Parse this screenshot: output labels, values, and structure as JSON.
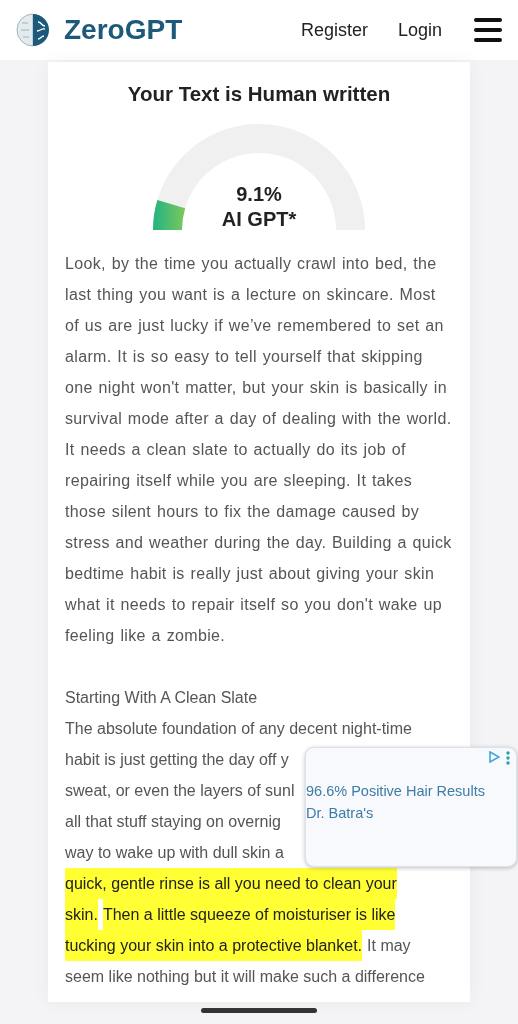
{
  "header": {
    "brand": "ZeroGPT",
    "nav": [
      "Register",
      "Login"
    ]
  },
  "result": {
    "title": "Your Text is Human written",
    "gauge": {
      "reading": "9.1%",
      "caption": "AI GPT*"
    }
  },
  "paragraphs": [
    {
      "text": "Look, by the time you actually crawl into bed, the last thing you want is a lecture on skincare. Most of us are just lucky if we’ve remembered to set an alarm. It is so easy to tell yourself that skipping one night won't matter, but your skin is basically in survival mode after a day of dealing with the world. It needs a clean slate to actually do its job of repairing itself while you are sleeping. It takes those silent hours to fix the damage caused by stress and weather during the day. Building a quick bedtime habit is really just about giving your skin what it needs to repair itself so you don't wake up feeling like a zombie."
    }
  ],
  "section": {
    "heading": "Starting With A Clean Slate",
    "lines": [
      [
        {
          "text": "The absolute foundation of any decent night-time",
          "highlighted": false
        }
      ],
      [
        {
          "text": "habit is just getting the day off y",
          "highlighted": false
        }
      ],
      [
        {
          "text": "sweat, or even the layers of sunl",
          "highlighted": false
        }
      ],
      [
        {
          "text": "all that stuff staying on overnig",
          "highlighted": false
        }
      ],
      [
        {
          "text": "way to wake up with dull skin a",
          "highlighted": false
        }
      ],
      [
        {
          "text": "quick, gentle rinse is all you need to clean your",
          "highlighted": true
        }
      ],
      [
        {
          "text": "skin.",
          "highlighted": true
        },
        {
          "text": "Then a little squeeze of moisturiser is like",
          "highlighted": true
        }
      ],
      [
        {
          "text": "tucking your skin into a protective blanket.",
          "highlighted": true
        },
        {
          "text": "It may",
          "highlighted": false
        }
      ],
      [
        {
          "text": "seem like nothing but it will make such a difference",
          "highlighted": false
        }
      ]
    ]
  },
  "ad": {
    "lines": [
      "96.6% Positive Hair Results",
      "Dr. Batra's"
    ]
  }
}
